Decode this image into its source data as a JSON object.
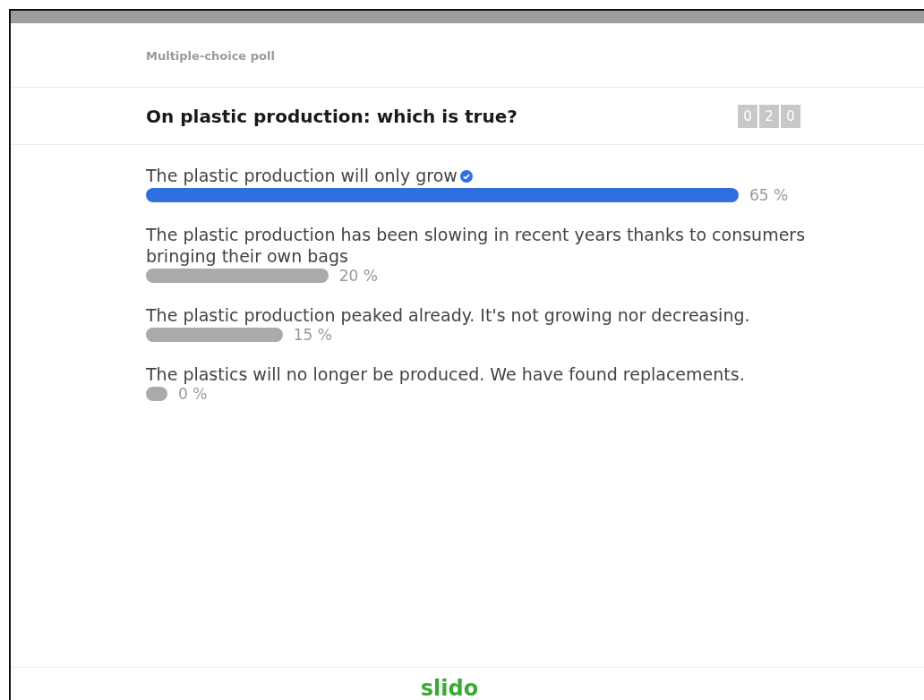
{
  "poll_type": "Multiple-choice poll",
  "question": "On plastic production: which is true?",
  "counter": [
    "0",
    "2",
    "0"
  ],
  "options": [
    {
      "text": "The plastic production will only grow",
      "correct": true,
      "reading": "65 %"
    },
    {
      "text": "The plastic production has been slowing in recent years thanks to consumers bringing their own bags",
      "correct": false,
      "reading": "20 %"
    },
    {
      "text": "The plastic production peaked already. It's not growing nor decreasing.",
      "correct": false,
      "reading": "15 %"
    },
    {
      "text": "The plastics will no longer be produced. We have found replacements.",
      "correct": false,
      "reading": "0 %"
    }
  ],
  "footer_logo": "slido"
}
